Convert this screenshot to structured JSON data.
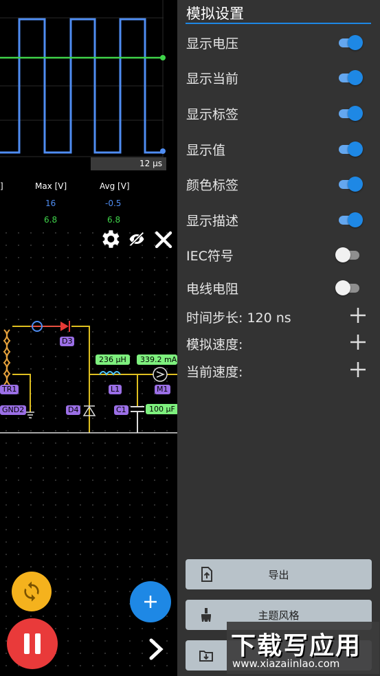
{
  "scope": {
    "time_label": "12 μs",
    "columns": [
      "]",
      "Max [V]",
      "Avg [V]"
    ],
    "row1": {
      "max": "16",
      "avg": "-0.5"
    },
    "row2": {
      "max": "6.8",
      "avg": "6.8"
    }
  },
  "circuit": {
    "labels": [
      "D3",
      "TR1",
      "L1",
      "M1",
      "GND2",
      "D4",
      "C1"
    ],
    "values": [
      "236 μH",
      "339.2 mA",
      "100 μF"
    ]
  },
  "panel": {
    "title": "模拟设置",
    "toggles": [
      {
        "label": "显示电压",
        "on": true
      },
      {
        "label": "显示当前",
        "on": true
      },
      {
        "label": "显示标签",
        "on": true
      },
      {
        "label": "显示值",
        "on": true
      },
      {
        "label": "颜色标签",
        "on": true
      },
      {
        "label": "显示描述",
        "on": true
      },
      {
        "label": "IEC符号",
        "on": false
      },
      {
        "label": "电线电阻",
        "on": false
      }
    ],
    "steppers": [
      {
        "label": "时间步长: 120 ns"
      },
      {
        "label": "模拟速度:"
      },
      {
        "label": "当前速度:"
      }
    ],
    "buttons": [
      {
        "label": "导出",
        "icon": "upload-file-icon"
      },
      {
        "label": "主题风格",
        "icon": "brush-icon"
      },
      {
        "label": "",
        "icon": "import-file-icon"
      }
    ]
  },
  "watermark": {
    "main": "下载写应用",
    "sub": "www.xiazaiinlao.com"
  },
  "colors": {
    "accent": "#1e88e5",
    "panel": "#333333",
    "pause": "#e93a3a",
    "refresh": "#f5b21d",
    "trace_blue": "#4f8df2",
    "trace_green": "#3fd34a"
  }
}
